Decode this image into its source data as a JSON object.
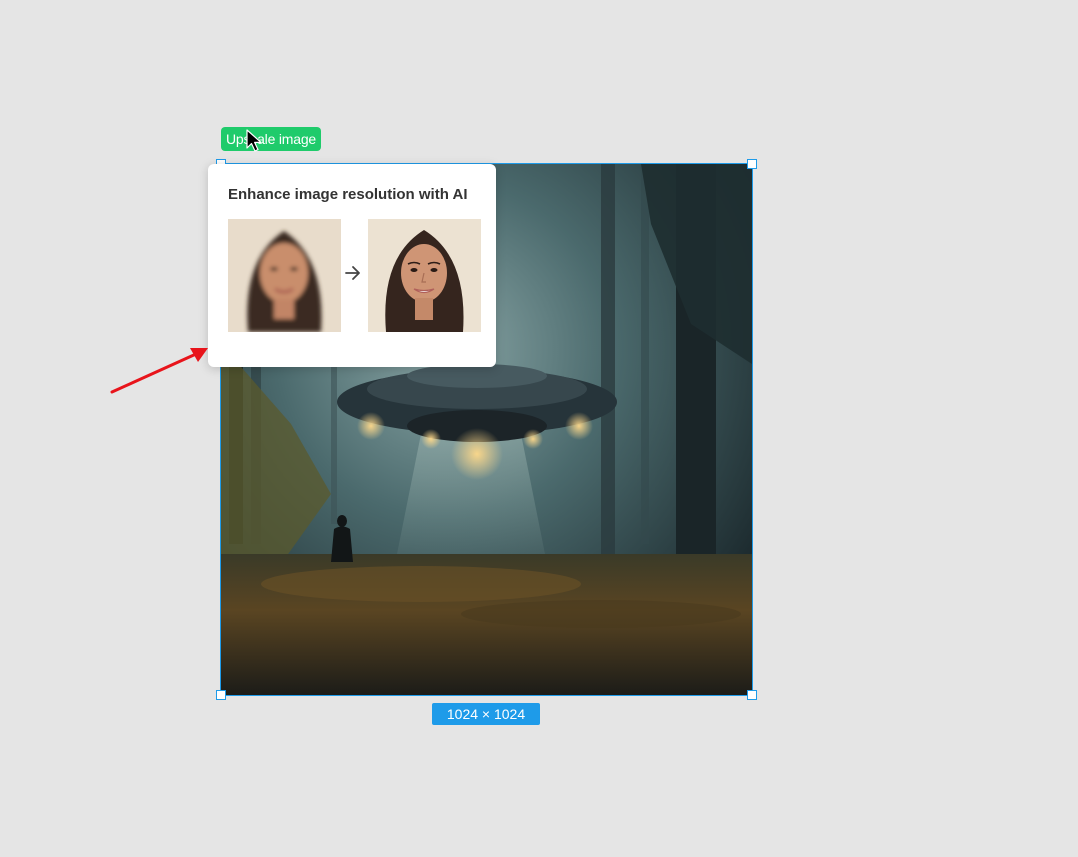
{
  "action_chip": {
    "label": "Upscale image"
  },
  "tooltip": {
    "title": "Enhance image resolution with AI",
    "before_image": "blurry-portrait",
    "after_image": "sharp-portrait",
    "arrow_icon": "arrow-right-icon"
  },
  "canvas_image": {
    "description_icon": "ufo-forest-image",
    "size_label": "1024 × 1024"
  },
  "colors": {
    "selection": "#1e9be9",
    "action_chip": "#1fcb6b",
    "annotation": "#e8141b",
    "canvas_bg": "#e5e5e5"
  }
}
